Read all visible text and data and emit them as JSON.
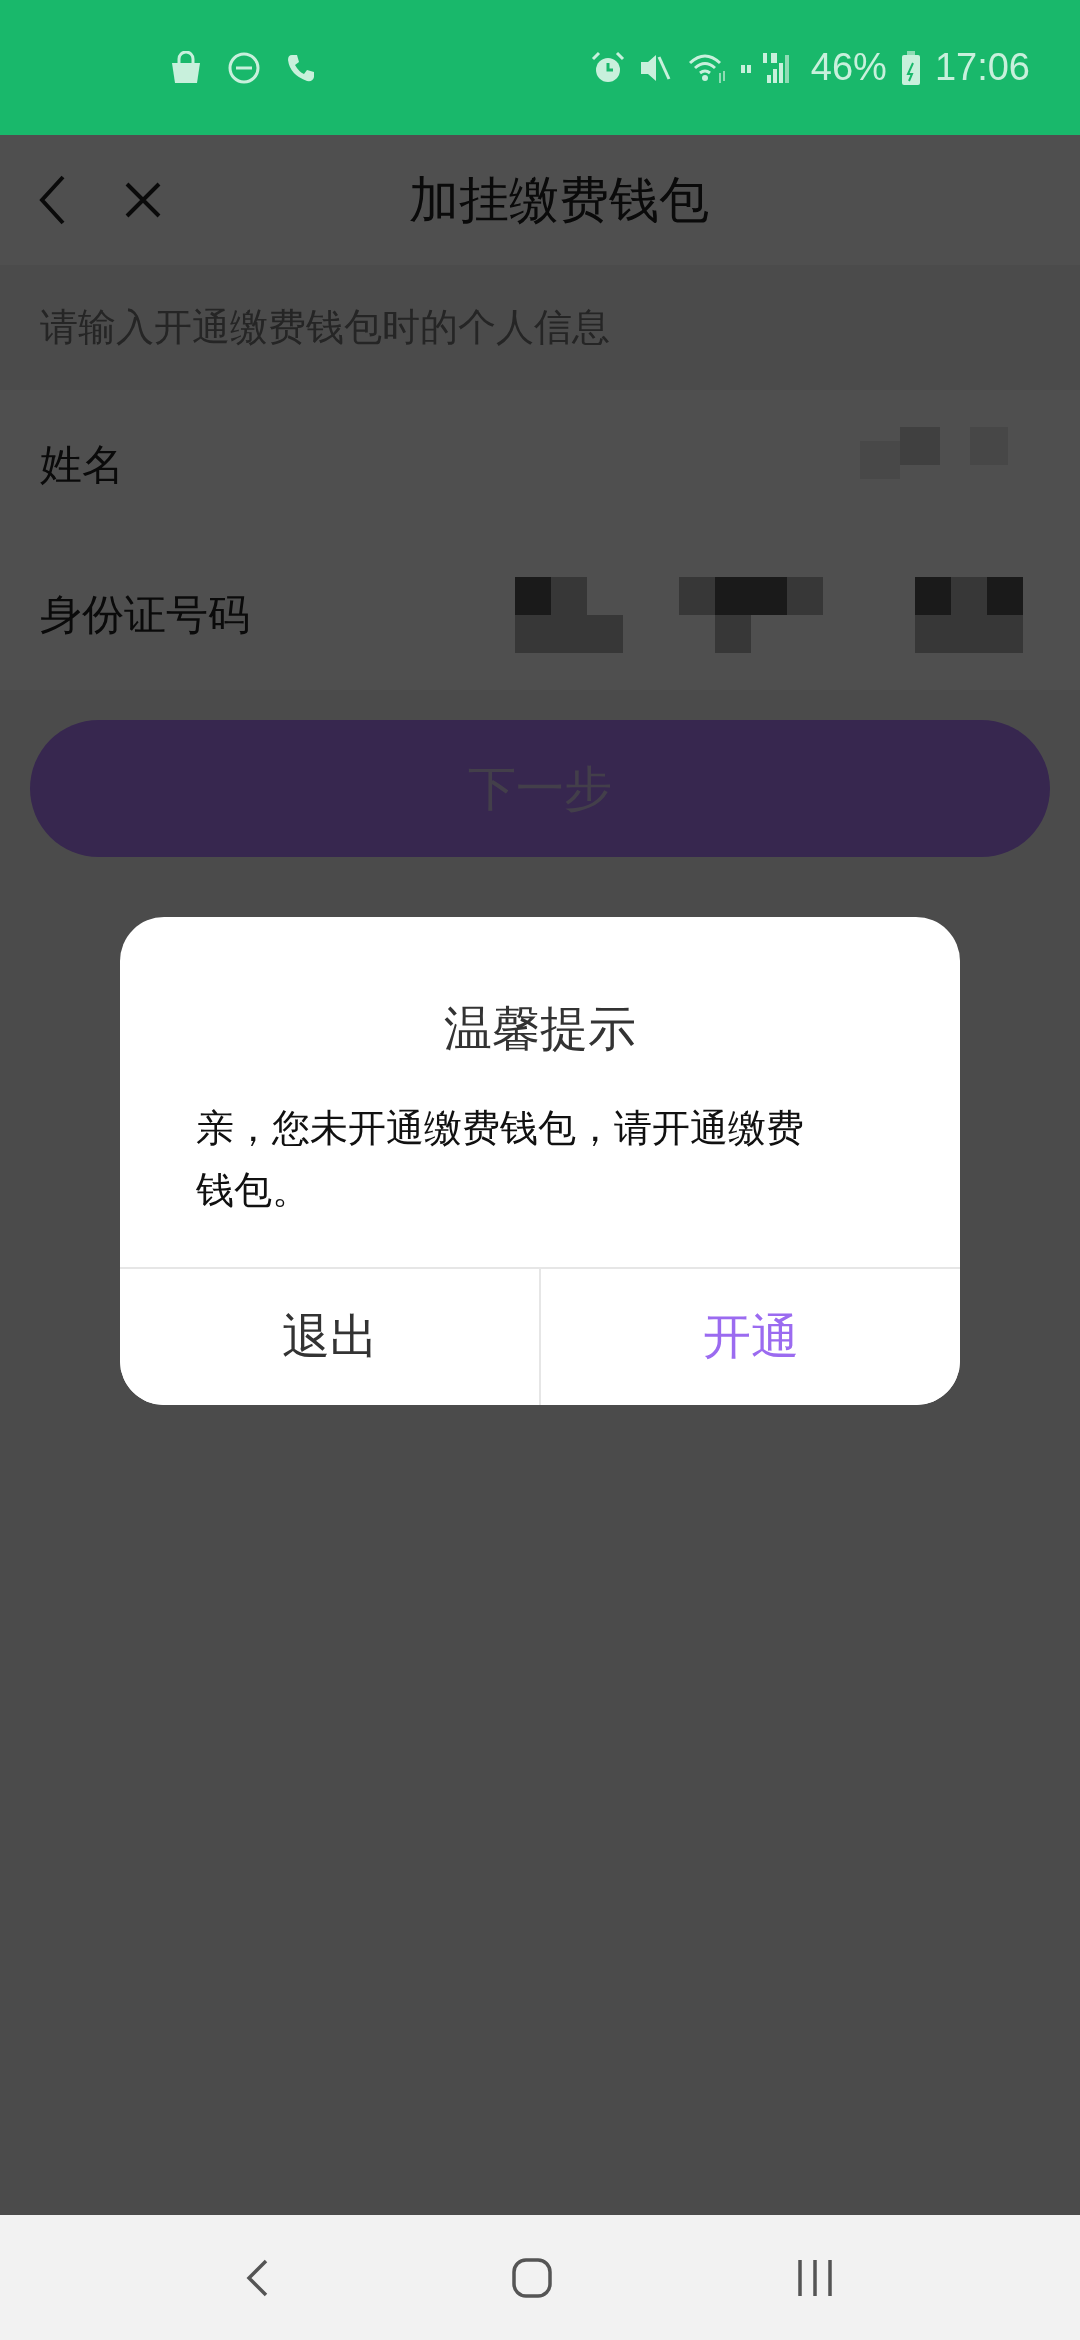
{
  "status_bar": {
    "battery": "46%",
    "time": "17:06"
  },
  "header": {
    "title": "加挂缴费钱包"
  },
  "form": {
    "hint": "请输入开通缴费钱包时的个人信息",
    "fields": [
      {
        "label": "姓名"
      },
      {
        "label": "身份证号码"
      }
    ]
  },
  "next_button": {
    "label": "下一步",
    "disabled": true
  },
  "dialog": {
    "title": "温馨提示",
    "message": "亲，您未开通缴费钱包，请开通缴费钱包。",
    "buttons": [
      {
        "label": "退出",
        "kind": "cancel"
      },
      {
        "label": "开通",
        "kind": "confirm"
      }
    ]
  }
}
